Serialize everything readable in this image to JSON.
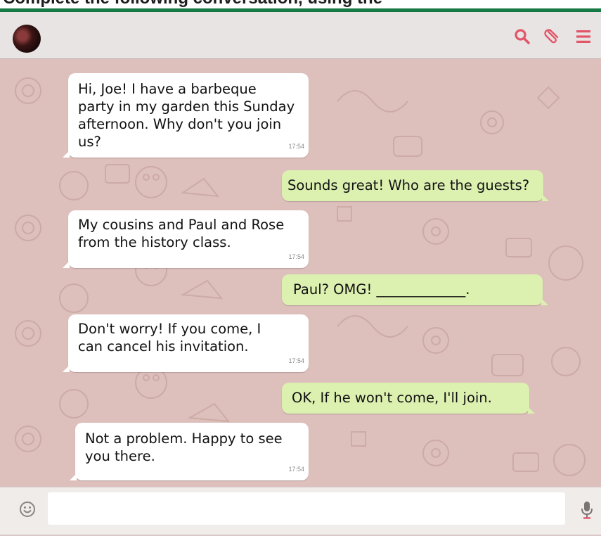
{
  "page": {
    "heading": "Complete the following conversation, using the"
  },
  "header": {
    "avatar_icon": "profile-photo",
    "actions": [
      {
        "icon": "search-icon",
        "label": "Search"
      },
      {
        "icon": "paperclip-icon",
        "label": "Attach"
      },
      {
        "icon": "menu-icon",
        "label": "Menu"
      }
    ]
  },
  "messages": [
    {
      "direction": "incoming",
      "text": "Hi, Joe! I have a barbeque\nparty in my garden this Sunday\nafternoon. Why don't you join\nus?",
      "time": "17:54"
    },
    {
      "direction": "outgoing",
      "text": "Sounds great! Who are the guests?",
      "time": ""
    },
    {
      "direction": "incoming",
      "text": "My cousins and Paul and Rose\nfrom the history class.",
      "time": "17:54"
    },
    {
      "direction": "outgoing",
      "text": "Paul? OMG! _____________.",
      "time": ""
    },
    {
      "direction": "incoming",
      "text": "Don't worry! If you come, I\ncan cancel his invitation.",
      "time": "17:54"
    },
    {
      "direction": "outgoing",
      "text": "OK, If he won't come, I'll join.",
      "time": ""
    },
    {
      "direction": "incoming",
      "text": "Not a problem. Happy to see\nyou there.",
      "time": "17:54"
    }
  ],
  "composer": {
    "input_value": "",
    "emoji_icon": "emoji-icon",
    "mic_icon": "microphone-icon"
  },
  "colors": {
    "accent_rule": "#177a45",
    "wallpaper": "#ddbfbc",
    "incoming_bubble": "#ffffff",
    "outgoing_bubble": "#dcf0b0",
    "icon_color": "#e2566a"
  }
}
